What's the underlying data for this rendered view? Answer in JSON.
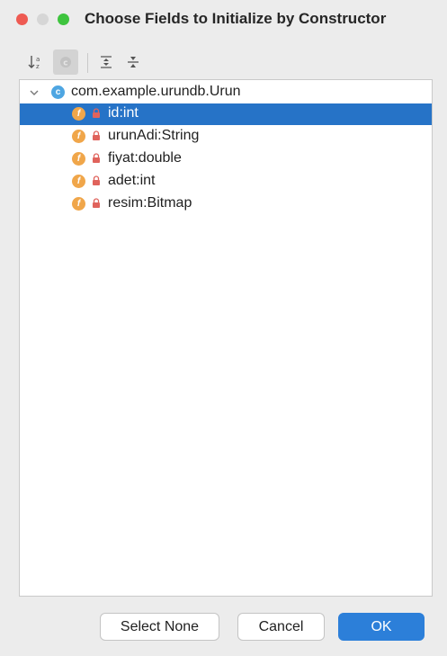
{
  "window": {
    "title": "Choose Fields to Initialize by Constructor"
  },
  "toolbar": {
    "sort_icon": "sort-alphabetically-icon",
    "class_icon": "show-classes-icon",
    "expand_icon": "expand-all-icon",
    "collapse_icon": "collapse-all-icon"
  },
  "tree": {
    "root": {
      "icon": "class-icon",
      "icon_letter": "c",
      "label": "com.example.urundb.Urun",
      "expanded": true
    },
    "fields": [
      {
        "icon_letter": "f",
        "label": "id:int",
        "selected": true
      },
      {
        "icon_letter": "f",
        "label": "urunAdi:String",
        "selected": false
      },
      {
        "icon_letter": "f",
        "label": "fiyat:double",
        "selected": false
      },
      {
        "icon_letter": "f",
        "label": "adet:int",
        "selected": false
      },
      {
        "icon_letter": "f",
        "label": "resim:Bitmap",
        "selected": false
      }
    ]
  },
  "buttons": {
    "select_none": "Select None",
    "cancel": "Cancel",
    "ok": "OK"
  },
  "colors": {
    "selection": "#2673c7",
    "ok_button": "#2c7fd9",
    "field_icon": "#f0a64a",
    "class_icon": "#4ea6e2",
    "lock_icon": "#e0635c"
  }
}
